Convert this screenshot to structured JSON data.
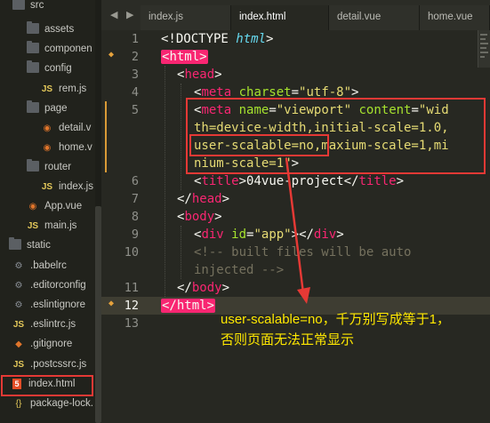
{
  "sidebar": {
    "items": [
      {
        "label": "src",
        "icon": "folder-icon"
      },
      {
        "label": "assets",
        "icon": "folder-icon"
      },
      {
        "label": "componen",
        "icon": "folder-icon"
      },
      {
        "label": "config",
        "icon": "folder-icon"
      },
      {
        "label": "rem.js",
        "icon": "js-file-icon",
        "icon_text": "JS"
      },
      {
        "label": "page",
        "icon": "folder-icon"
      },
      {
        "label": "detail.v",
        "icon": "rss-file-icon"
      },
      {
        "label": "home.v",
        "icon": "rss-file-icon"
      },
      {
        "label": "router",
        "icon": "folder-icon"
      },
      {
        "label": "index.js",
        "icon": "js-file-icon",
        "icon_text": "JS"
      },
      {
        "label": "App.vue",
        "icon": "rss-file-icon"
      },
      {
        "label": "main.js",
        "icon": "js-file-icon",
        "icon_text": "JS"
      },
      {
        "label": "static",
        "icon": "folder-icon"
      },
      {
        "label": ".babelrc",
        "icon": "gear-icon"
      },
      {
        "label": ".editorconfig",
        "icon": "gear-icon"
      },
      {
        "label": ".eslintignore",
        "icon": "gear-icon"
      },
      {
        "label": ".eslintrc.js",
        "icon": "js-file-icon",
        "icon_text": "JS"
      },
      {
        "label": ".gitignore",
        "icon": "git-icon"
      },
      {
        "label": ".postcssrc.js",
        "icon": "js-file-icon",
        "icon_text": "JS"
      },
      {
        "label": "index.html",
        "icon": "html5-icon",
        "icon_text": "5"
      },
      {
        "label": "package-lock.",
        "icon": "json-icon",
        "icon_text": "{}"
      }
    ]
  },
  "tabs": [
    {
      "label": "index.js",
      "active": false
    },
    {
      "label": "index.html",
      "active": true
    },
    {
      "label": "detail.vue",
      "active": false
    },
    {
      "label": "home.vue",
      "active": false
    }
  ],
  "tab_nav": {
    "prev": "◀",
    "next": "▶"
  },
  "editor": {
    "line_numbers": [
      "1",
      "2",
      "3",
      "4",
      "5",
      "",
      "",
      "",
      "6",
      "7",
      "8",
      "9",
      "10",
      "",
      "11",
      "12",
      "13"
    ],
    "lines": {
      "l1": {
        "a": "<!DOCTYPE ",
        "b": "html",
        "c": ">"
      },
      "l2": {
        "open": "<",
        "tag": "html",
        "close": ">"
      },
      "l3": {
        "open": "<",
        "tag": "head",
        "close": ">"
      },
      "l4": {
        "open": "<",
        "tag": "meta",
        "attr": " charset",
        "eq": "=",
        "val": "\"utf-8\"",
        "close": ">"
      },
      "l5a": {
        "open": "<",
        "tag": "meta",
        "attr1": " name",
        "eq1": "=",
        "val1": "\"viewport\"",
        "attr2": " content",
        "eq2": "=",
        "val2": "\"wid"
      },
      "l5b": {
        "val": "th=device-width,initial-scale=1.0,"
      },
      "l5c": {
        "val1": "user-scalable=no",
        "val2": ",maxium-scale=1,mi"
      },
      "l5d": {
        "val": "nium-scale=1\"",
        "close": ">"
      },
      "l6": {
        "open": "<",
        "tag": "title",
        "close": ">",
        "text": "04vue-project",
        "end_open": "</",
        "end_tag": "title",
        "end_close": ">"
      },
      "l7": {
        "open": "</",
        "tag": "head",
        "close": ">"
      },
      "l8": {
        "open": "<",
        "tag": "body",
        "close": ">"
      },
      "l9": {
        "open": "<",
        "tag": "div",
        "attr": " id",
        "eq": "=",
        "val": "\"app\"",
        "close": ">",
        "end_open": "</",
        "end_tag": "div",
        "end_close": ">"
      },
      "l10a": {
        "text": "<!-- built files will be auto"
      },
      "l10b": {
        "text": "injected -->"
      },
      "l11": {
        "open": "</",
        "tag": "body",
        "close": ">"
      },
      "l12": {
        "open": "</",
        "tag": "html",
        "close": ">"
      }
    }
  },
  "annotation": {
    "line1": "user-scalable=no，千万别写成等于1，",
    "line2": "否则页面无法正常显示"
  },
  "colors": {
    "background": "#272822",
    "tag": "#f92672",
    "attribute": "#a6e22e",
    "string": "#e6db74",
    "comment": "#75715e",
    "highlight_box": "#e53935",
    "annotation_text": "#ffe800"
  }
}
